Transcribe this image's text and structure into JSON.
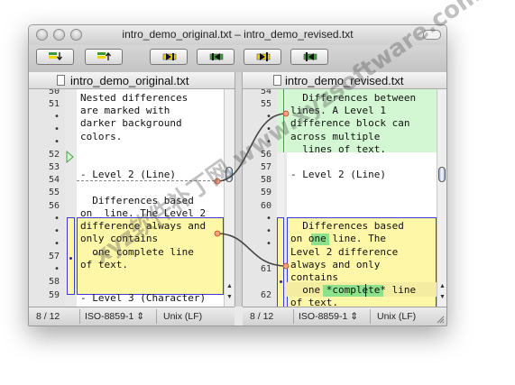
{
  "window": {
    "title": "intro_demo_original.txt – intro_demo_revised.txt"
  },
  "toolbar": {
    "buttons": [
      {
        "name": "copy-to-left-button",
        "icon": "arrow-down-icon"
      },
      {
        "name": "copy-to-right-button",
        "icon": "arrow-up-icon"
      },
      {
        "name": "next-difference-button",
        "icon": "next-icon"
      },
      {
        "name": "previous-difference-button",
        "icon": "previous-icon"
      },
      {
        "name": "apply-right-button",
        "icon": "merge-right-icon"
      },
      {
        "name": "apply-left-button",
        "icon": "merge-left-icon"
      }
    ]
  },
  "left_pane": {
    "filename": "intro_demo_original.txt",
    "line_numbers": [
      "50",
      "51",
      "•",
      "•",
      "•",
      "52",
      "53",
      "54",
      "55",
      "56",
      "•",
      "•",
      "•",
      "57",
      "•",
      "58",
      "59"
    ],
    "text": [
      "Nested differences",
      "are marked with",
      "darker background",
      "colors.",
      "",
      "- Level 2 (Line)",
      "",
      "  Differences based",
      "on  line. The Level 2",
      "difference always and",
      "only contains",
      "  one complete line",
      "of text.",
      "",
      "- Level 3 (Character)"
    ],
    "status": {
      "position": "8 / 12",
      "encoding": "ISO-8859-1",
      "line_endings": "Unix (LF)"
    }
  },
  "right_pane": {
    "filename": "intro_demo_revised.txt",
    "line_numbers": [
      "54",
      "55",
      "•",
      "•",
      "•",
      "56",
      "57",
      "58",
      "59",
      "60",
      "•",
      "•",
      "•",
      "61",
      "62"
    ],
    "text": [
      "  Differences between",
      "lines. A Level 1",
      "difference block can",
      "across multiple",
      "  lines of text.",
      "",
      "- Level 2 (Line)",
      "",
      "  Differences based",
      "on one line. The",
      "Level 2 difference",
      "always and only",
      "contains",
      "  one *complete* line",
      "of text."
    ],
    "highlights": [
      "one",
      "*complete*"
    ],
    "status": {
      "position": "8 / 12",
      "encoding": "ISO-8859-1",
      "line_endings": "Unix (LF)"
    }
  },
  "watermark": {
    "text": "xyz软件补丁网  www.xyzsoftware.com"
  },
  "colors": {
    "change_block": "#fff7a8",
    "change_border": "#3a3ad8",
    "insert_block": "#d2f7d2",
    "char_highlight": "#8be28b",
    "connector": "#444444"
  }
}
